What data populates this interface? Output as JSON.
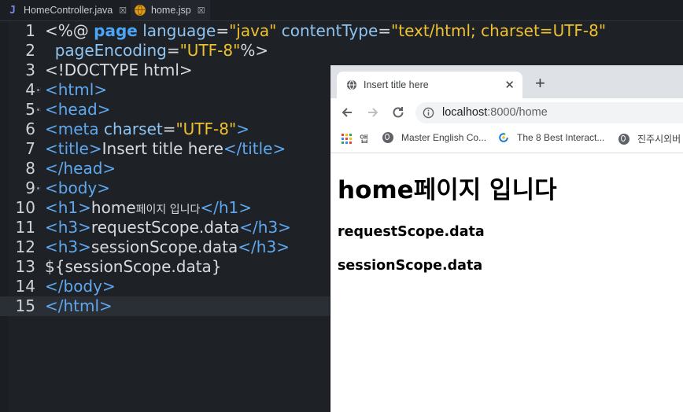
{
  "editor": {
    "tabs": [
      {
        "label": "HomeController.java",
        "icon": "java-file-icon",
        "active": false
      },
      {
        "label": "home.jsp",
        "icon": "jsp-file-icon",
        "active": true
      }
    ],
    "close_glyph": "☒",
    "current_line": 15,
    "lines": [
      {
        "num": "1",
        "fold": false,
        "tokens": [
          {
            "t": "<%@ ",
            "c": "plain"
          },
          {
            "t": "page",
            "c": "kw"
          },
          {
            "t": " ",
            "c": "plain"
          },
          {
            "t": "language",
            "c": "attr"
          },
          {
            "t": "=",
            "c": "plain"
          },
          {
            "t": "\"java\"",
            "c": "val"
          },
          {
            "t": " ",
            "c": "plain"
          },
          {
            "t": "contentType",
            "c": "attr"
          },
          {
            "t": "=",
            "c": "plain"
          },
          {
            "t": "\"text/html; charset=UTF-8\"",
            "c": "val"
          }
        ]
      },
      {
        "num": "2",
        "fold": false,
        "tokens": [
          {
            "t": "  ",
            "c": "plain"
          },
          {
            "t": "pageEncoding",
            "c": "attr"
          },
          {
            "t": "=",
            "c": "plain"
          },
          {
            "t": "\"UTF-8\"",
            "c": "val"
          },
          {
            "t": "%>",
            "c": "plain"
          }
        ]
      },
      {
        "num": "3",
        "fold": false,
        "tokens": [
          {
            "t": "<!DOCTYPE html>",
            "c": "plain"
          }
        ]
      },
      {
        "num": "4",
        "fold": true,
        "tokens": [
          {
            "t": "<html>",
            "c": "tag"
          }
        ]
      },
      {
        "num": "5",
        "fold": true,
        "tokens": [
          {
            "t": "<head>",
            "c": "tag"
          }
        ]
      },
      {
        "num": "6",
        "fold": false,
        "tokens": [
          {
            "t": "<meta ",
            "c": "tag"
          },
          {
            "t": "charset",
            "c": "attr"
          },
          {
            "t": "=",
            "c": "plain"
          },
          {
            "t": "\"UTF-8\"",
            "c": "val"
          },
          {
            "t": ">",
            "c": "tag"
          }
        ]
      },
      {
        "num": "7",
        "fold": false,
        "tokens": [
          {
            "t": "<title>",
            "c": "tag"
          },
          {
            "t": "Insert title here",
            "c": "plain"
          },
          {
            "t": "</title>",
            "c": "tag"
          }
        ]
      },
      {
        "num": "8",
        "fold": false,
        "tokens": [
          {
            "t": "</head>",
            "c": "tag"
          }
        ]
      },
      {
        "num": "9",
        "fold": true,
        "tokens": [
          {
            "t": "<body>",
            "c": "tag"
          }
        ]
      },
      {
        "num": "10",
        "fold": false,
        "tokens": [
          {
            "t": "<h1>",
            "c": "tag"
          },
          {
            "t": "home",
            "c": "plain"
          },
          {
            "t": "페이지 입니다",
            "c": "plain",
            "small": true
          },
          {
            "t": "</h1>",
            "c": "tag"
          }
        ]
      },
      {
        "num": "11",
        "fold": false,
        "tokens": [
          {
            "t": "<h3>",
            "c": "tag"
          },
          {
            "t": "requestScope.data",
            "c": "plain"
          },
          {
            "t": "</h3>",
            "c": "tag"
          }
        ]
      },
      {
        "num": "12",
        "fold": false,
        "tokens": [
          {
            "t": "<h3>",
            "c": "tag"
          },
          {
            "t": "sessionScope.data",
            "c": "plain"
          },
          {
            "t": "</h3>",
            "c": "tag"
          }
        ]
      },
      {
        "num": "13",
        "fold": false,
        "tokens": [
          {
            "t": "${sessionScope.data}",
            "c": "plain"
          }
        ]
      },
      {
        "num": "14",
        "fold": false,
        "tokens": [
          {
            "t": "</body>",
            "c": "tag"
          }
        ]
      },
      {
        "num": "15",
        "fold": false,
        "tokens": [
          {
            "t": "</html>",
            "c": "tag"
          }
        ]
      }
    ]
  },
  "browser": {
    "tab_title": "Insert title here",
    "tab_close": "✕",
    "new_tab": "+",
    "url_host": "localhost",
    "url_rest": ":8000/home",
    "bookmarks": [
      {
        "label": "앱",
        "icon": "apps-grid-icon"
      },
      {
        "label": "Master English Co...",
        "icon": "globe-icon"
      },
      {
        "label": "The 8 Best Interact...",
        "icon": "refresh-circle-icon"
      },
      {
        "label": "진주시외버",
        "icon": "globe-icon"
      }
    ],
    "page": {
      "h1": "home페이지 입니다",
      "h3_request": "requestScope.data",
      "h3_session": "sessionScope.data"
    }
  },
  "colors": {
    "tag": "#5fa8f0",
    "attribute": "#8fc3f0",
    "string_value": "#efc12f",
    "keyword": "#4ba5f5"
  }
}
